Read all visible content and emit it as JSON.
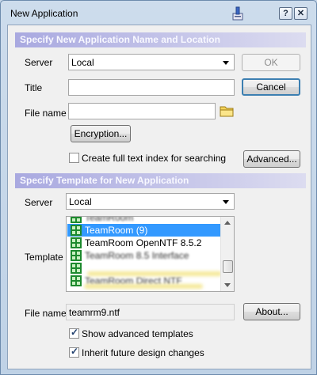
{
  "window": {
    "title": "New Application",
    "help_button": "?",
    "close_button": "✕"
  },
  "colors": {
    "section_header_start": "#a9a9e0",
    "section_header_end": "#dcdcf0",
    "selection": "#3399ff",
    "default_button_border": "#3c7fb1"
  },
  "icons": {
    "title": "application-icon",
    "browse": "folder-icon",
    "template": "notes-database-icon"
  },
  "location_section": {
    "header": "Specify New Application Name and Location",
    "server_label": "Server",
    "server_value": "Local",
    "title_label": "Title",
    "title_value": "",
    "filename_label": "File name",
    "filename_value": "",
    "encryption_button": "Encryption...",
    "fulltext_checkbox": {
      "label": "Create full text index for searching",
      "checked": false
    },
    "advanced_button": "Advanced...",
    "ok_button": "OK",
    "cancel_button": "Cancel"
  },
  "template_section": {
    "header": "Specify Template for New Application",
    "server_label": "Server",
    "server_value": "Local",
    "template_label": "Template",
    "templates": [
      {
        "label": "TeamRoom",
        "selected": false,
        "obscured": true
      },
      {
        "label": "TeamRoom (9)",
        "selected": true,
        "obscured": false
      },
      {
        "label": "TeamRoom OpenNTF 8.5.2",
        "selected": false,
        "obscured": false
      },
      {
        "label": "TeamRoom 8.5 Interface",
        "selected": false,
        "obscured": true
      },
      {
        "label": "",
        "selected": false,
        "obscured": true
      },
      {
        "label": "TeamRoom Direct NTF",
        "selected": false,
        "obscured": true
      }
    ],
    "filename_label": "File name",
    "filename_value": "teamrm9.ntf",
    "about_button": "About...",
    "show_advanced_checkbox": {
      "label": "Show advanced templates",
      "checked": true
    },
    "inherit_checkbox": {
      "label": "Inherit future design changes",
      "checked": true
    }
  }
}
